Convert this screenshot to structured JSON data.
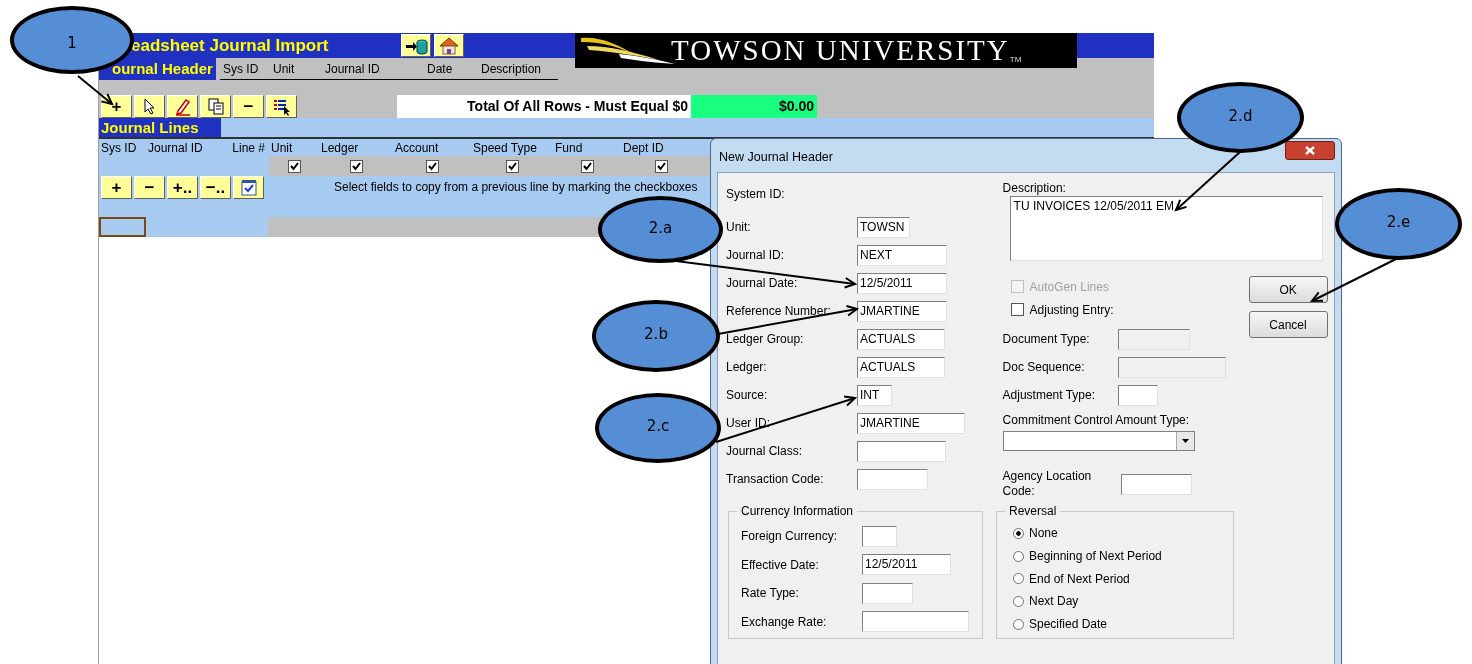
{
  "sheet": {
    "title": "eadsheet Journal Import",
    "title_icons": [
      {
        "kind": "import"
      },
      {
        "kind": "home"
      }
    ],
    "logo": {
      "text": "TOWSON UNIVERSITY",
      "mark": "TM"
    },
    "header_section": {
      "title": "ournal Header",
      "columns": [
        "Sys ID",
        "Unit",
        "Journal ID",
        "Date",
        "Description"
      ]
    },
    "header_toolbar": [
      {
        "kind": "text",
        "label": "+"
      },
      {
        "kind": "pointer"
      },
      {
        "kind": "pencil"
      },
      {
        "kind": "copy"
      },
      {
        "kind": "text",
        "label": "−"
      },
      {
        "kind": "list"
      }
    ],
    "total": {
      "label": "Total Of All Rows - Must Equal $0",
      "value": "$0.00"
    },
    "lines_section": {
      "title": "Journal Lines",
      "columns": [
        {
          "label": "Sys ID",
          "kind": "plain"
        },
        {
          "label": "Journal ID",
          "kind": "plain"
        },
        {
          "label": "Line #",
          "kind": "plain"
        },
        {
          "label": "Unit",
          "kind": "checkbox",
          "checked": true
        },
        {
          "label": "Ledger",
          "kind": "checkbox",
          "checked": true
        },
        {
          "label": "Account",
          "kind": "checkbox",
          "checked": true
        },
        {
          "label": "Speed Type",
          "kind": "checkbox",
          "checked": true
        },
        {
          "label": "Fund",
          "kind": "checkbox",
          "checked": true
        },
        {
          "label": "Dept ID",
          "kind": "checkbox",
          "checked": true
        }
      ]
    },
    "lines_toolbar": [
      {
        "kind": "text",
        "label": "+"
      },
      {
        "kind": "text",
        "label": "−"
      },
      {
        "kind": "text",
        "label": "+.."
      },
      {
        "kind": "text",
        "label": "−.."
      },
      {
        "kind": "check"
      }
    ],
    "copy_hint": "Select fields to copy from a previous line by marking the checkboxes"
  },
  "dialog": {
    "title": "New Journal Header",
    "fields": [
      {
        "label": "System ID:",
        "kind": "label"
      },
      {
        "label": "Unit:",
        "kind": "field",
        "value": "TOWSN"
      },
      {
        "label": "Journal ID:",
        "kind": "field",
        "value": "NEXT"
      },
      {
        "label": "Journal Date:",
        "kind": "field",
        "value": "12/5/2011"
      },
      {
        "label": "Reference Number:",
        "kind": "field",
        "value": "JMARTINE"
      },
      {
        "label": "Ledger Group:",
        "kind": "field",
        "value": "ACTUALS"
      },
      {
        "label": "Ledger:",
        "kind": "field",
        "value": "ACTUALS"
      },
      {
        "label": "Source:",
        "kind": "field",
        "value": "INT"
      },
      {
        "label": "User ID:",
        "kind": "field",
        "value": "JMARTINE"
      },
      {
        "label": "Journal Class:",
        "kind": "field"
      },
      {
        "label": "Transaction Code:",
        "kind": "field"
      }
    ],
    "description": {
      "label": "Description:",
      "value": "TU INVOICES 12/05/2011 EM"
    },
    "options": [
      {
        "label": "AutoGen Lines",
        "checked": false,
        "disabled": true
      },
      {
        "label": "Adjusting Entry:",
        "checked": false,
        "disabled": false
      }
    ],
    "right_fields": [
      {
        "label": "Document Type:",
        "disabled": true
      },
      {
        "label": "Doc Sequence:",
        "disabled": true
      },
      {
        "label": "Adjustment Type:",
        "disabled": false
      }
    ],
    "amount_type": {
      "label": "Commitment Control Amount Type:"
    },
    "agency": {
      "label": "Agency Location Code:"
    },
    "buttons": [
      "OK",
      "Cancel"
    ],
    "currency": {
      "title": "Currency Information",
      "fields": [
        {
          "label": "Foreign Currency:"
        },
        {
          "label": "Effective Date:",
          "value": "12/5/2011"
        },
        {
          "label": "Rate Type:"
        },
        {
          "label": "Exchange Rate:"
        }
      ]
    },
    "reversal": {
      "title": "Reversal",
      "options": [
        {
          "label": "None",
          "selected": true
        },
        {
          "label": "Beginning of Next Period",
          "selected": false
        },
        {
          "label": "End of Next Period",
          "selected": false
        },
        {
          "label": "Next Day",
          "selected": false
        },
        {
          "label": "Specified Date",
          "selected": false
        }
      ]
    }
  },
  "callouts": [
    {
      "label": "1"
    },
    {
      "label": "2.a"
    },
    {
      "label": "2.b"
    },
    {
      "label": "2.c"
    },
    {
      "label": "2.d"
    },
    {
      "label": "2.e"
    }
  ]
}
